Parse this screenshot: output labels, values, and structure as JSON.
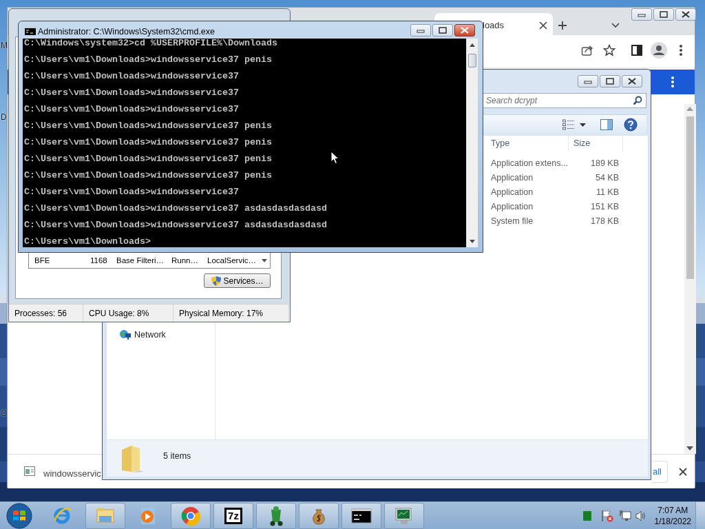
{
  "desktop": {
    "icon_labels": [
      "M",
      "D",
      "C"
    ]
  },
  "browser": {
    "tab_title": "loads",
    "download_item": "windowsservic",
    "show_all": "all"
  },
  "explorer": {
    "search_placeholder": "Search dcrypt",
    "columns": [
      "Type",
      "Size"
    ],
    "rows": [
      {
        "type": "Application extens...",
        "size": "189 KB"
      },
      {
        "type": "Application",
        "size": "54 KB"
      },
      {
        "type": "Application",
        "size": "11 KB"
      },
      {
        "type": "Application",
        "size": "151 KB"
      },
      {
        "type": "System file",
        "size": "178 KB"
      }
    ],
    "nav_items": [
      "Network"
    ],
    "status": "5 items"
  },
  "task_manager": {
    "service_row": [
      "BFE",
      "1168",
      "Base Filteri…",
      "Runn…",
      "LocalServic…"
    ],
    "services_button": "Services…",
    "status_bar": [
      "Processes: 56",
      "CPU Usage: 8%",
      "Physical Memory: 17%"
    ]
  },
  "console": {
    "title": "Administrator: C:\\Windows\\System32\\cmd.exe",
    "lines": [
      "C:\\Windows\\system32>cd %USERPROFILE%\\Downloads",
      "C:\\Users\\vm1\\Downloads>windowsservice37 penis",
      "C:\\Users\\vm1\\Downloads>windowsservice37",
      "C:\\Users\\vm1\\Downloads>windowsservice37",
      "C:\\Users\\vm1\\Downloads>windowsservice37",
      "C:\\Users\\vm1\\Downloads>windowsservice37 penis",
      "C:\\Users\\vm1\\Downloads>windowsservice37 penis",
      "C:\\Users\\vm1\\Downloads>windowsservice37 penis",
      "C:\\Users\\vm1\\Downloads>windowsservice37 penis",
      "C:\\Users\\vm1\\Downloads>windowsservice37",
      "C:\\Users\\vm1\\Downloads>windowsservice37 asdasdasdasdasd",
      "C:\\Users\\vm1\\Downloads>windowsservice37 asdasdasdasdasd",
      "C:\\Users\\vm1\\Downloads>"
    ]
  },
  "taskbar": {
    "apps": [
      {
        "kind": "ie",
        "running": false
      },
      {
        "kind": "explorer",
        "running": true
      },
      {
        "kind": "media",
        "running": false
      },
      {
        "kind": "chrome",
        "running": true
      },
      {
        "kind": "sevenzip",
        "running": true,
        "logo_text": "7z"
      },
      {
        "kind": "figure",
        "running": true
      },
      {
        "kind": "moneybag",
        "running": true
      },
      {
        "kind": "console",
        "running": true
      },
      {
        "kind": "monitor",
        "running": true
      }
    ],
    "clock_time": "7:07 AM",
    "clock_date": "1/18/2022"
  }
}
